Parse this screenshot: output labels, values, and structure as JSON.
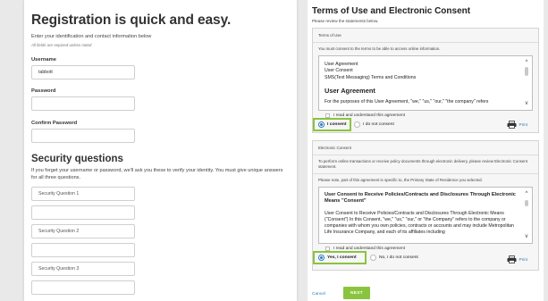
{
  "registration": {
    "title": "Registration is quick and easy.",
    "intro": "Enter your identification and contact information below",
    "required_note": "All fields are required unless noted",
    "username_label": "Username",
    "username_value": "tabbott",
    "password_label": "Password",
    "password_value": "",
    "confirm_label": "Confirm Password",
    "confirm_value": "",
    "security_title": "Security questions",
    "security_desc": "If you forget your username or password, we'll ask you these to verify your identity. You must give unique answers for all three questions.",
    "questions": [
      {
        "label": "Security Question 1",
        "answer": ""
      },
      {
        "label": "Security Question 2",
        "answer": ""
      },
      {
        "label": "Security Question 3",
        "answer": ""
      }
    ]
  },
  "consent": {
    "title": "Terms of Use and Electronic Consent",
    "review": "Please review the statements below.",
    "terms": {
      "section_title": "Terms of Use",
      "instruction": "You must consent to the terms to be able to access online information.",
      "list": [
        "User Agreement",
        "User Consent",
        "SMS(Text Messaging) Terms and Conditions"
      ],
      "heading": "User Agreement",
      "paragraph": "For the purposes of this User Agreement, \"we,\" \"us,\" \"our,\" \"the company\" refers",
      "checkbox_label": "I read and understand this agreement",
      "consent_label": "I consent",
      "decline_label": "I do not consent",
      "print_label": "Print"
    },
    "electronic": {
      "section_title": "Electronic Consent",
      "instruction": "To perform online transactions or receive policy documents through electronic delivery, please review Electronic Consent statement.",
      "note": "Please note, part of this agreement is specific to, the Primary State of Residence you selected.",
      "heading": "User Consent to Receive Policies/Contracts and Disclosures Through Electronic Means \"Consent\"",
      "paragraph": "User Consent to Receive Policies/Contracts and Disclosures Through Electronic Means (\"Consent\") In this Consent, \"we,\" \"us,\" \"our,\" or \"the Company\" refers to the company or companies with whom you own policies, contracts or accounts and may include Metropolitan Life Insurance Company, and each of its affiliates including",
      "checkbox_label": "I read and understand this agreement",
      "consent_label": "Yes, I consent",
      "decline_label": "No, I do not consent",
      "print_label": "Print"
    },
    "cancel_label": "Cancel",
    "next_label": "NEXT"
  },
  "colors": {
    "accent": "#8ac43f",
    "link": "#2f7ac0"
  }
}
